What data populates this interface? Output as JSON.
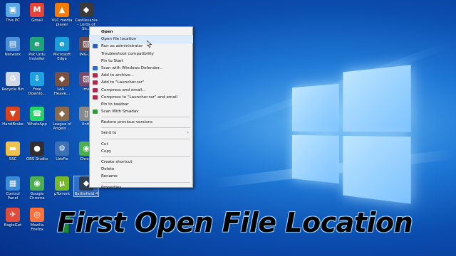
{
  "desktop": {
    "icons": [
      {
        "label": "This PC",
        "icon": "monitor-icon",
        "color": "#5aa7e8"
      },
      {
        "label": "Gmail",
        "icon": "gmail-icon",
        "color": "#ea4335"
      },
      {
        "label": "VLC media player",
        "icon": "vlc-icon",
        "color": "#f57c00"
      },
      {
        "label": "Castlevania - Lords of Sh...",
        "icon": "game-cover-icon",
        "color": "#3a3a3a"
      },
      {
        "label": "Network",
        "icon": "network-icon",
        "color": "#4a8fd8"
      },
      {
        "label": "Psk Urdu Installer",
        "icon": "edge-icon",
        "color": "#1fa37a"
      },
      {
        "label": "Microsoft Edge",
        "icon": "edge-icon",
        "color": "#1a9ed8"
      },
      {
        "label": "IMG-20",
        "icon": "image-icon",
        "color": "#6a4a4a"
      },
      {
        "label": "Recycle Bin",
        "icon": "recycle-bin-icon",
        "color": "#cfd8e3"
      },
      {
        "label": "Free Downlo...",
        "icon": "free-download-icon",
        "color": "#1fa1e0"
      },
      {
        "label": "LoA - Heave...",
        "icon": "game-cover-icon",
        "color": "#7a5040"
      },
      {
        "label": "ima",
        "icon": "image-icon",
        "color": "#7a4a6a"
      },
      {
        "label": "HandBrake",
        "icon": "handbrake-icon",
        "color": "#d9441c"
      },
      {
        "label": "WhatsApp",
        "icon": "whatsapp-icon",
        "color": "#25d366"
      },
      {
        "label": "League of Angels ...",
        "icon": "game-cover-icon",
        "color": "#8a6a4a"
      },
      {
        "label": "Untit",
        "icon": "file-icon",
        "color": "#8a8a8a"
      },
      {
        "label": "SSC",
        "icon": "folder-icon",
        "color": "#f0c24a"
      },
      {
        "label": "OBS Studio",
        "icon": "obs-icon",
        "color": "#302e31"
      },
      {
        "label": "UzbFix",
        "icon": "tool-icon",
        "color": "#3c6fb4"
      },
      {
        "label": "Chrom",
        "icon": "chrome-icon",
        "color": "#4caf50"
      },
      {
        "label": "Control Panel",
        "icon": "control-panel-icon",
        "color": "#3a8ad8"
      },
      {
        "label": "Google Chrome",
        "icon": "chrome-icon",
        "color": "#4caf50"
      },
      {
        "label": "µTorrent",
        "icon": "utorrent-icon",
        "color": "#76b82a"
      },
      {
        "label": "Battlefield 4",
        "icon": "game-cover-icon",
        "color": "#2f3d52"
      },
      {
        "label": "EagleGet",
        "icon": "eagleget-icon",
        "color": "#e14b3c"
      },
      {
        "label": "Mozilla Firefox",
        "icon": "firefox-icon",
        "color": "#ff7139"
      }
    ]
  },
  "context_menu": {
    "items": [
      {
        "type": "item",
        "label": "Open",
        "bold": true,
        "icon": ""
      },
      {
        "type": "item",
        "label": "Open file location",
        "hover": true,
        "icon": ""
      },
      {
        "type": "item",
        "label": "Run as administrator",
        "icon": "shield-icon",
        "icon_color": "#2f5fbf"
      },
      {
        "type": "item",
        "label": "Troubleshoot compatibility",
        "icon": ""
      },
      {
        "type": "item",
        "label": "Pin to Start",
        "icon": ""
      },
      {
        "type": "item",
        "label": "Scan with Windows Defender...",
        "icon": "defender-icon",
        "icon_color": "#2b6cc4"
      },
      {
        "type": "item",
        "label": "Add to archive...",
        "icon": "winrar-icon",
        "icon_color": "#b0284a"
      },
      {
        "type": "item",
        "label": "Add to \"Launcher.rar\"",
        "icon": "winrar-icon",
        "icon_color": "#b0284a"
      },
      {
        "type": "item",
        "label": "Compress and email...",
        "icon": "winrar-icon",
        "icon_color": "#b0284a"
      },
      {
        "type": "item",
        "label": "Compress to \"Launcher.rar\" and email",
        "icon": "winrar-icon",
        "icon_color": "#b0284a"
      },
      {
        "type": "item",
        "label": "Pin to taskbar",
        "icon": ""
      },
      {
        "type": "item",
        "label": "Scan With Smadav",
        "icon": "smadav-icon",
        "icon_color": "#2e9a3a"
      },
      {
        "type": "sep"
      },
      {
        "type": "item",
        "label": "Restore previous versions",
        "icon": ""
      },
      {
        "type": "sep"
      },
      {
        "type": "item",
        "label": "Send to",
        "icon": "",
        "submenu": true
      },
      {
        "type": "sep"
      },
      {
        "type": "item",
        "label": "Cut",
        "icon": ""
      },
      {
        "type": "item",
        "label": "Copy",
        "icon": ""
      },
      {
        "type": "sep"
      },
      {
        "type": "item",
        "label": "Create shortcut",
        "icon": ""
      },
      {
        "type": "item",
        "label": "Delete",
        "icon": ""
      },
      {
        "type": "item",
        "label": "Rename",
        "icon": ""
      },
      {
        "type": "sep"
      },
      {
        "type": "item",
        "label": "Properties",
        "icon": ""
      }
    ]
  },
  "caption": {
    "text": "First Open File Location",
    "arrow_color": "#1d8a2c"
  }
}
